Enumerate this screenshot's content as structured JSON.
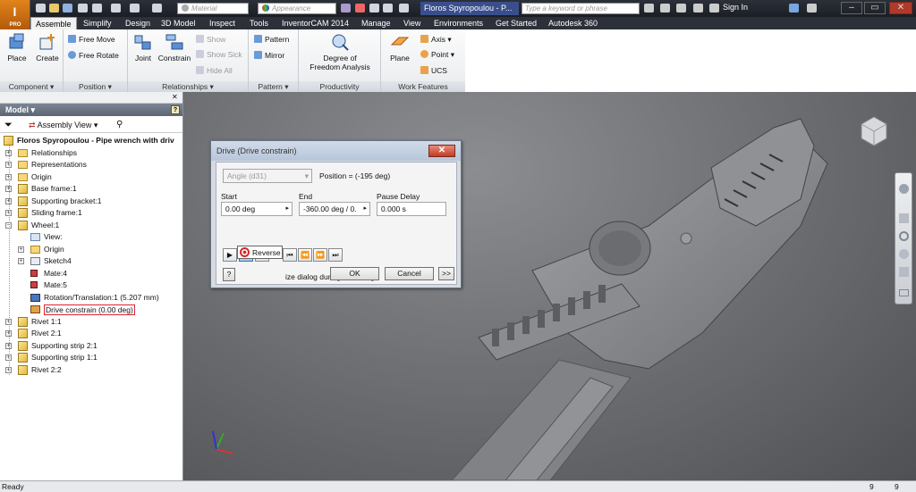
{
  "app": {
    "logo": "I",
    "logo_sub": "PRO"
  },
  "title_bar": {
    "material": "Material",
    "appearance": "Appearance",
    "document_title": "Floros Spyropoulou - P...",
    "search_placeholder": "Type a keyword or phrase",
    "sign_in": "Sign In"
  },
  "tabs": [
    "Assemble",
    "Simplify",
    "Design",
    "3D Model",
    "Inspect",
    "Tools",
    "InventorCAM 2014",
    "Manage",
    "View",
    "Environments",
    "Get Started",
    "Autodesk 360"
  ],
  "active_tab": "Assemble",
  "ribbon": {
    "place": "Place",
    "create": "Create",
    "free_move": "Free Move",
    "free_rotate": "Free Rotate",
    "joint": "Joint",
    "constrain": "Constrain",
    "show": "Show",
    "show_sick": "Show Sick",
    "hide_all": "Hide All",
    "pattern": "Pattern",
    "mirror": "Mirror",
    "dof_line1": "Degree of",
    "dof_line2": "Freedom Analysis",
    "plane": "Plane",
    "axis": "Axis",
    "point": "Point",
    "ucs": "UCS",
    "panels": {
      "component": "Component",
      "position": "Position",
      "relationships": "Relationships",
      "pattern": "Pattern",
      "productivity": "Productivity",
      "work_features": "Work Features"
    }
  },
  "browser": {
    "header": "Model",
    "view": "Assembly View",
    "root": "Floros Spyropoulou - Pipe wrench with driv",
    "items": [
      {
        "label": "Relationships",
        "icon": "folder",
        "indent": 0
      },
      {
        "label": "Representations",
        "icon": "folder",
        "indent": 0
      },
      {
        "label": "Origin",
        "icon": "folder",
        "indent": 0
      },
      {
        "label": "Base frame:1",
        "icon": "part",
        "indent": 0
      },
      {
        "label": "Supporting bracket:1",
        "icon": "part",
        "indent": 0
      },
      {
        "label": "Sliding frame:1",
        "icon": "part",
        "indent": 0
      },
      {
        "label": "Wheel:1",
        "icon": "part",
        "indent": 0
      },
      {
        "label": "View:",
        "icon": "view",
        "indent": 1
      },
      {
        "label": "Origin",
        "icon": "folder",
        "indent": 1
      },
      {
        "label": "Sketch4",
        "icon": "sketch",
        "indent": 1
      },
      {
        "label": "Mate:4",
        "icon": "mate",
        "indent": 1
      },
      {
        "label": "Mate:5",
        "icon": "mate",
        "indent": 1
      },
      {
        "label": "Rotation/Translation:1 (5.207 mm)",
        "icon": "rotation",
        "indent": 1
      },
      {
        "label": "Drive constrain (0.00 deg)",
        "icon": "drive",
        "indent": 1
      },
      {
        "label": "Rivet 1:1",
        "icon": "part",
        "indent": 0
      },
      {
        "label": "Rivet 2:1",
        "icon": "part",
        "indent": 0
      },
      {
        "label": "Supporting strip 2:1",
        "icon": "part",
        "indent": 0
      },
      {
        "label": "Supporting strip 1:1",
        "icon": "part",
        "indent": 0
      },
      {
        "label": "Rivet 2:2",
        "icon": "part",
        "indent": 0
      }
    ]
  },
  "dialog": {
    "title": "Drive (Drive constrain)",
    "angle": "Angle (d31)",
    "position": "Position = (-195 deg)",
    "start_label": "Start",
    "start": "0.00 deg",
    "end_label": "End",
    "end": "-360.00 deg / 0.",
    "pause_label": "Pause Delay",
    "pause": "0.000 s",
    "minimize_text": "ize dialog during recording",
    "ok": "OK",
    "cancel": "Cancel",
    "more": ">>",
    "tooltip": "Reverse"
  },
  "status": {
    "left": "Ready",
    "num1": "9",
    "num2": "9"
  }
}
